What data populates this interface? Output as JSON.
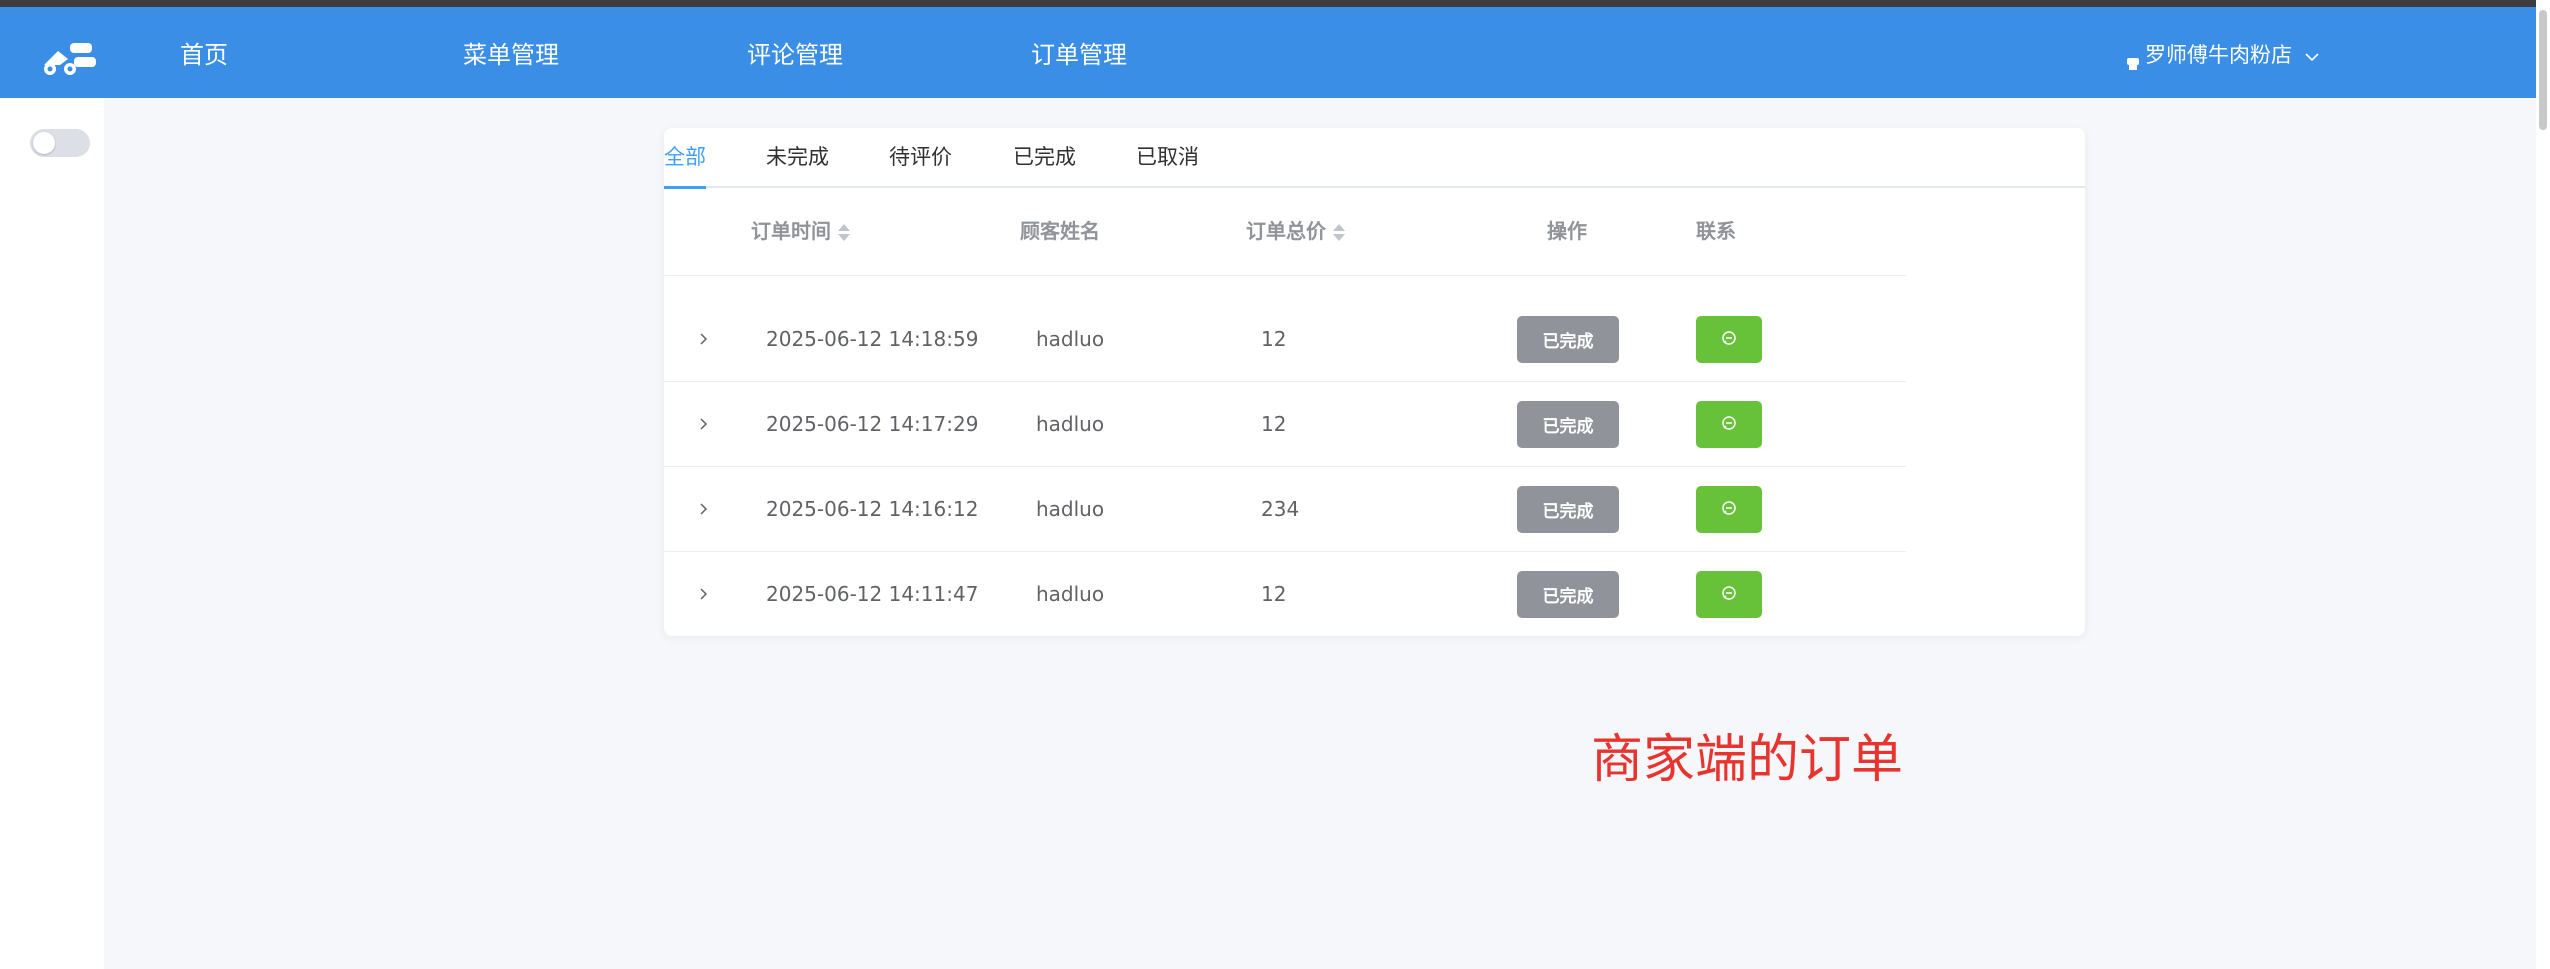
{
  "nav": {
    "items": [
      {
        "label": "首页"
      },
      {
        "label": "菜单管理"
      },
      {
        "label": "评论管理"
      },
      {
        "label": "订单管理"
      }
    ],
    "user_label": "罗师傅牛肉粉店",
    "user_icon": "store-icon",
    "user_chevron": "chevron-down-icon"
  },
  "tabs": [
    {
      "label": "全部",
      "active": true
    },
    {
      "label": "未完成"
    },
    {
      "label": "待评价"
    },
    {
      "label": "已完成"
    },
    {
      "label": "已取消"
    }
  ],
  "table": {
    "columns": {
      "time": "订单时间",
      "customer": "顾客姓名",
      "total": "订单总价",
      "action": "操作",
      "contact": "联系"
    },
    "rows": [
      {
        "time": "2025-06-12 14:18:59",
        "customer": "hadluo",
        "total": "12",
        "status": "已完成"
      },
      {
        "time": "2025-06-12 14:17:29",
        "customer": "hadluo",
        "total": "12",
        "status": "已完成"
      },
      {
        "time": "2025-06-12 14:16:12",
        "customer": "hadluo",
        "total": "234",
        "status": "已完成"
      },
      {
        "time": "2025-06-12 14:11:47",
        "customer": "hadluo",
        "total": "12",
        "status": "已完成"
      }
    ]
  },
  "annotation": "商家端的订单",
  "colors": {
    "navbar": "#3a8ee6",
    "accent": "#409eff",
    "status_done": "#909399",
    "chat_button": "#67c23a",
    "annotation": "#e8342f"
  }
}
